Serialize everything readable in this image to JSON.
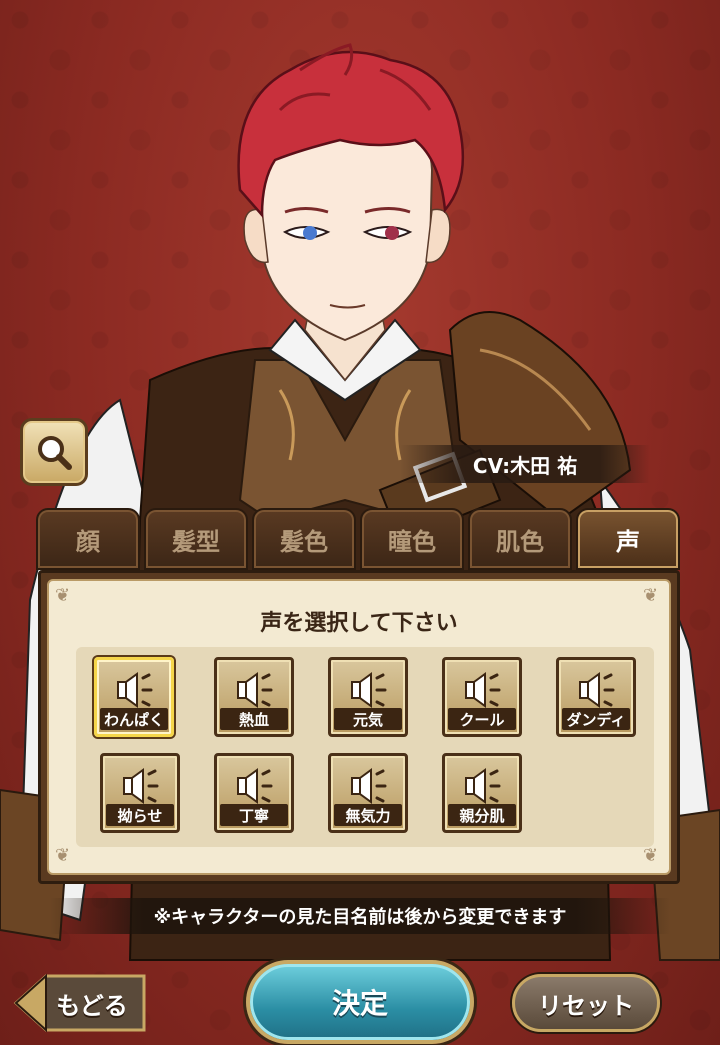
{
  "cv_label": "CV:木田 祐",
  "tabs": [
    {
      "label": "顔",
      "active": false
    },
    {
      "label": "髪型",
      "active": false
    },
    {
      "label": "髪色",
      "active": false
    },
    {
      "label": "瞳色",
      "active": false
    },
    {
      "label": "肌色",
      "active": false
    },
    {
      "label": "声",
      "active": true
    }
  ],
  "panel": {
    "title": "声を選択して下さい",
    "voices": [
      {
        "label": "わんぱく",
        "selected": true
      },
      {
        "label": "熱血",
        "selected": false
      },
      {
        "label": "元気",
        "selected": false
      },
      {
        "label": "クール",
        "selected": false
      },
      {
        "label": "ダンディ",
        "selected": false
      },
      {
        "label": "拗らせ",
        "selected": false
      },
      {
        "label": "丁寧",
        "selected": false
      },
      {
        "label": "無気力",
        "selected": false
      },
      {
        "label": "親分肌",
        "selected": false
      }
    ]
  },
  "notice": "※キャラクターの見た目名前は後から変更できます",
  "buttons": {
    "back": "もどる",
    "confirm": "決定",
    "reset": "リセット"
  },
  "icons": {
    "zoom": "magnifier-icon",
    "voice": "speaker-icon",
    "back": "arrow-left-icon"
  },
  "colors": {
    "background": "#8b2a22",
    "hair": "#c8303c",
    "panel": "#f3ead2",
    "selected_border": "#f5d54a",
    "confirm": "#2b8ea4"
  }
}
